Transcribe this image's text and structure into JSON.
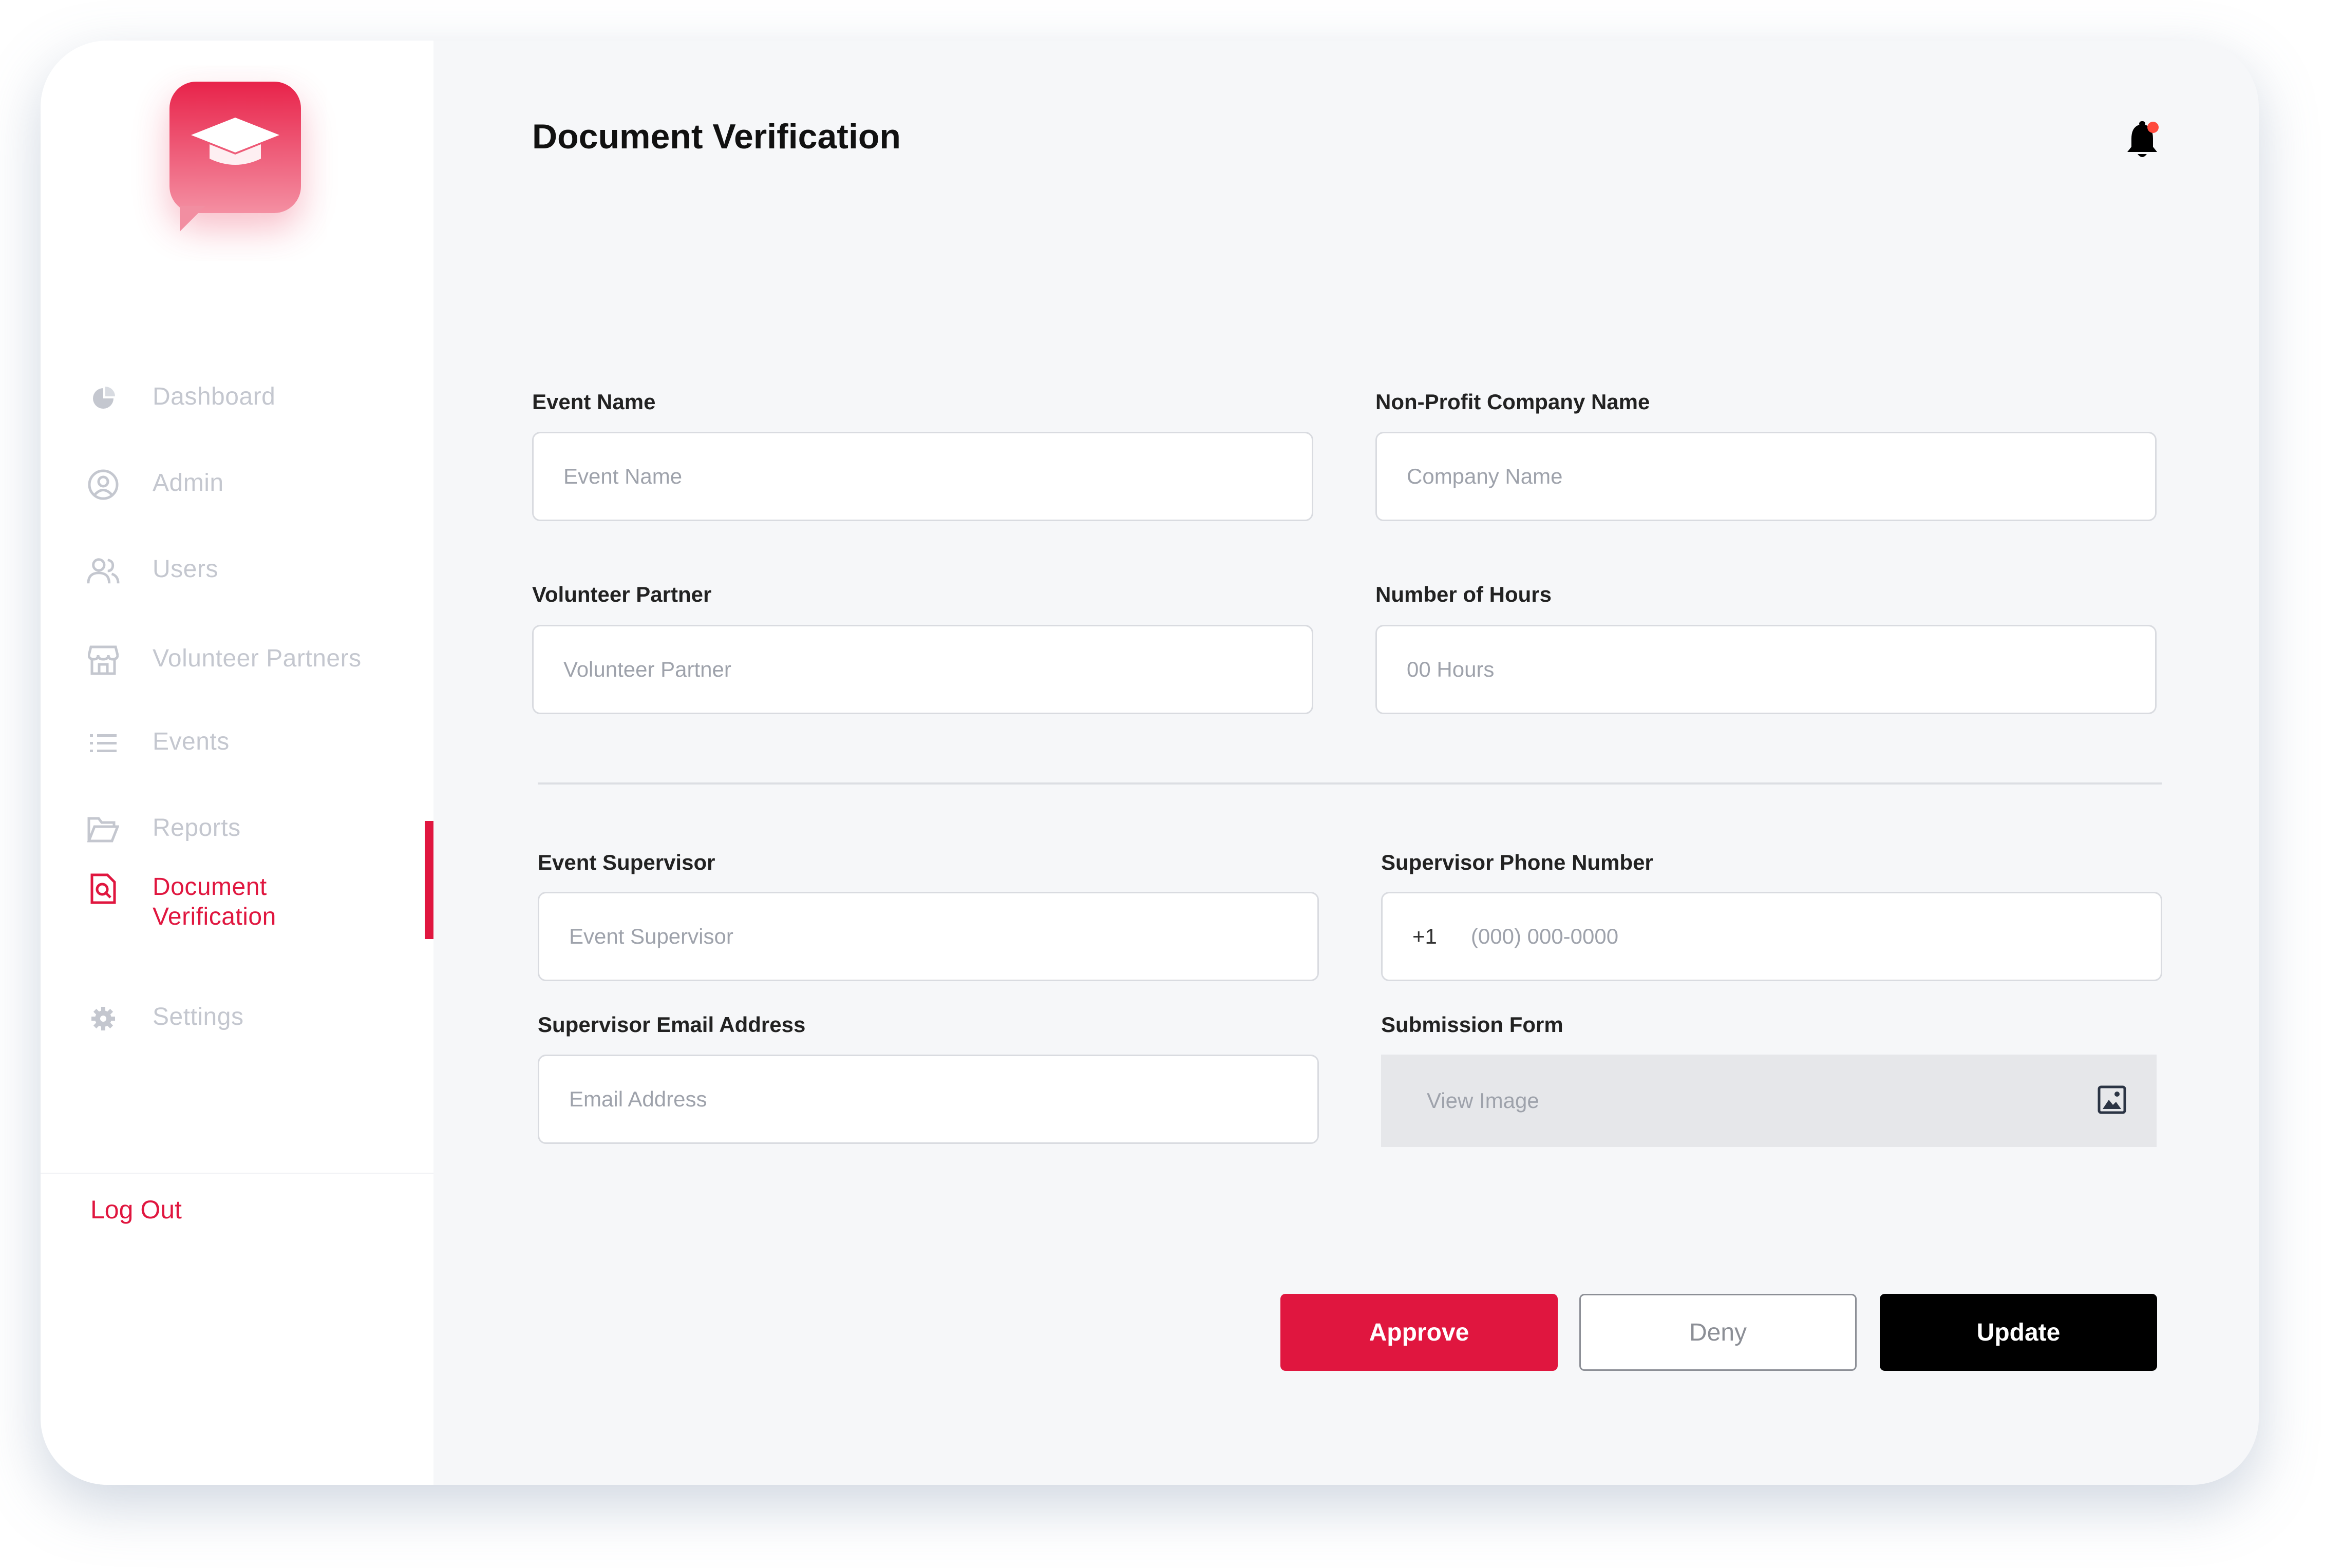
{
  "app": {
    "brand_color": "#e0163f"
  },
  "sidebar": {
    "items": [
      {
        "label": "Dashboard",
        "icon": "pie-chart-icon",
        "active": false
      },
      {
        "label": "Admin",
        "icon": "user-circle-icon",
        "active": false
      },
      {
        "label": "Users",
        "icon": "users-icon",
        "active": false
      },
      {
        "label": "Volunteer Partners",
        "icon": "storefront-icon",
        "active": false
      },
      {
        "label": "Events",
        "icon": "list-icon",
        "active": false
      },
      {
        "label": "Reports",
        "icon": "folder-icon",
        "active": false
      },
      {
        "label": "Document\nVerification",
        "icon": "document-search-icon",
        "active": true
      },
      {
        "label": "Settings",
        "icon": "gear-icon",
        "active": false
      }
    ],
    "logout_label": "Log Out"
  },
  "header": {
    "title": "Document Verification",
    "notification_icon": "bell-icon"
  },
  "form": {
    "event_name": {
      "label": "Event Name",
      "placeholder": "Event Name"
    },
    "company_name": {
      "label": "Non-Profit Company Name",
      "placeholder": "Company Name"
    },
    "volunteer_partner": {
      "label": "Volunteer Partner",
      "placeholder": "Volunteer Partner"
    },
    "hours": {
      "label": "Number of Hours",
      "placeholder": "00 Hours"
    },
    "supervisor": {
      "label": "Event Supervisor",
      "placeholder": "Event Supervisor"
    },
    "supervisor_phone": {
      "label": "Supervisor Phone Number",
      "prefix": "+1",
      "placeholder": "(000) 000-0000"
    },
    "supervisor_email": {
      "label": "Supervisor Email Address",
      "placeholder": "Email Address"
    },
    "submission_form": {
      "label": "Submission Form",
      "value": "View Image",
      "icon": "image-icon"
    }
  },
  "actions": {
    "approve_label": "Approve",
    "deny_label": "Deny",
    "update_label": "Update"
  }
}
